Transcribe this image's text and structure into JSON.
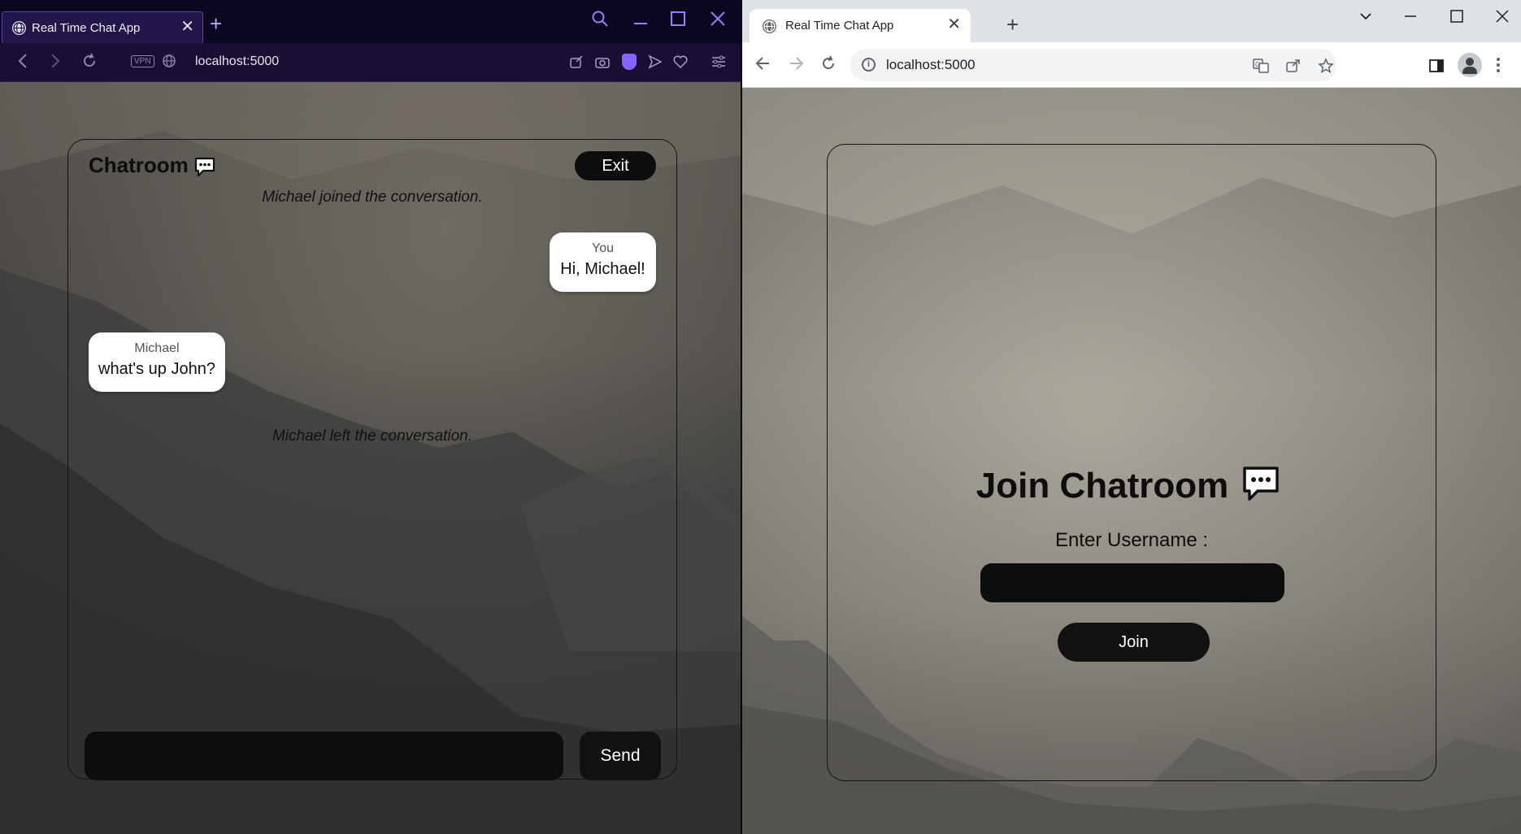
{
  "left_window": {
    "tab_title": "Real Time Chat App",
    "url": "localhost:5000",
    "vpn_badge": "VPN",
    "chatroom": {
      "title": "Chatroom",
      "exit_label": "Exit",
      "messages": [
        {
          "type": "system",
          "text": "Michael joined the conversation."
        },
        {
          "type": "outgoing",
          "sender": "You",
          "text": "Hi, Michael!"
        },
        {
          "type": "incoming",
          "sender": "Michael",
          "text": "what's up John?"
        },
        {
          "type": "system",
          "text": "Michael left the conversation."
        }
      ],
      "message_input_value": "",
      "send_label": "Send"
    }
  },
  "right_window": {
    "tab_title": "Real Time Chat App",
    "url": "localhost:5000",
    "join": {
      "title": "Join Chatroom",
      "username_label": "Enter Username :",
      "username_value": "",
      "join_label": "Join"
    }
  }
}
